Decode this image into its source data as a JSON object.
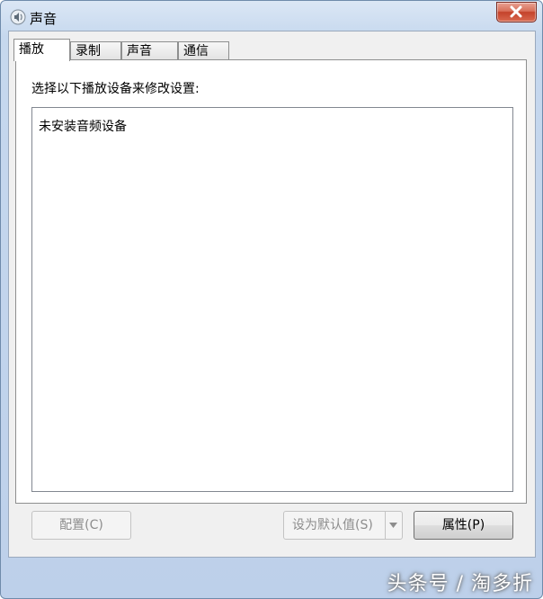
{
  "window": {
    "title": "声音"
  },
  "tabs": [
    {
      "label": "播放",
      "active": true
    },
    {
      "label": "录制",
      "active": false
    },
    {
      "label": "声音",
      "active": false
    },
    {
      "label": "通信",
      "active": false
    }
  ],
  "panel": {
    "instruction": "选择以下播放设备来修改设置:",
    "empty_message": "未安装音频设备"
  },
  "buttons": {
    "configure": "配置(C)",
    "set_default": "设为默认值(S)",
    "properties": "属性(P)"
  },
  "watermark": "头条号 / 淘多折",
  "colors": {
    "close_button": "#c4422b",
    "titlebar": "#c6d8ee"
  }
}
